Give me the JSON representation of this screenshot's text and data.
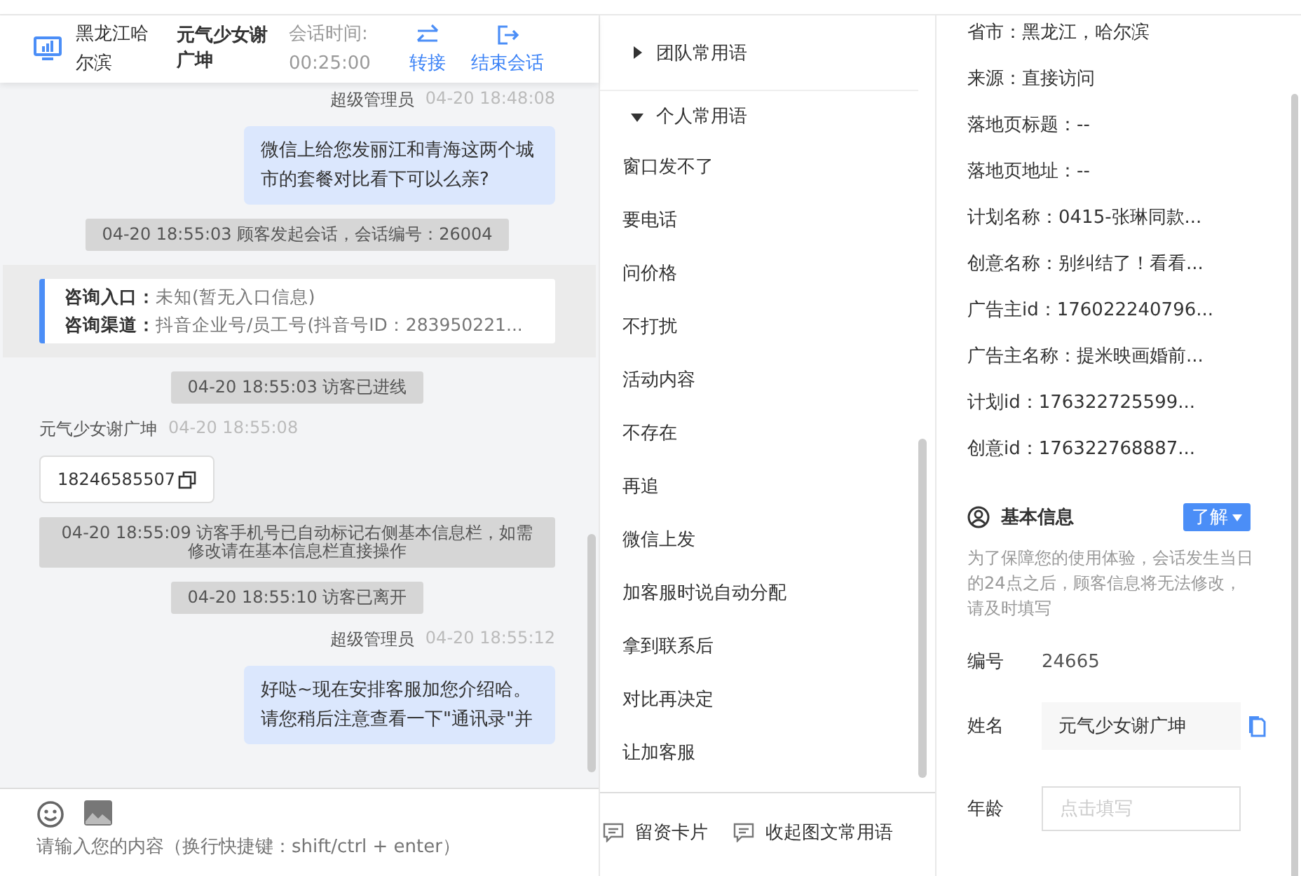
{
  "header": {
    "location": "黑龙江哈尔滨",
    "visitor": "元气少女谢广坤",
    "time_label": "会话时间:",
    "time": "00:25:00",
    "actions": [
      {
        "kind": "transfer",
        "label": "转接"
      },
      {
        "kind": "end",
        "label": "结束会话"
      }
    ]
  },
  "messages": [
    {
      "kind": "agent",
      "name": "超级管理员",
      "time": "04-20 18:48:08",
      "text": "微信上给您发丽江和青海这两个城市的套餐对比看下可以么亲?"
    },
    {
      "kind": "system",
      "text": "04-20 18:55:03 顾客发起会话，会话编号：26004"
    },
    {
      "kind": "entry",
      "rows": [
        {
          "label": "咨询入口：",
          "value": "未知(暂无入口信息)"
        },
        {
          "label": "咨询渠道：",
          "value": "抖音企业号/员工号(抖音号ID：283950221..."
        }
      ]
    },
    {
      "kind": "system",
      "text": "04-20 18:55:03 访客已进线"
    },
    {
      "kind": "visitor",
      "name": "元气少女谢广坤",
      "time": "04-20 18:55:08",
      "text": "18246585507"
    },
    {
      "kind": "system",
      "text": "04-20 18:55:09 访客手机号已自动标记右侧基本信息栏，如需修改请在基本信息栏直接操作"
    },
    {
      "kind": "system",
      "text": "04-20 18:55:10 访客已离开"
    },
    {
      "kind": "agent",
      "name": "超级管理员",
      "time": "04-20 18:55:12",
      "text": "好哒~现在安排客服加您介绍哈。请您稍后注意查看一下\"通讯录\"并"
    }
  ],
  "composer": {
    "placeholder": "请输入您的内容（换行快捷键：shift/ctrl + enter）"
  },
  "phrases": {
    "groups": [
      {
        "title": "团队常用语",
        "expanded": false
      },
      {
        "title": "个人常用语",
        "expanded": true,
        "children": [
          {
            "label": "窗口发不了"
          },
          {
            "label": "要电话"
          },
          {
            "label": "问价格"
          },
          {
            "label": "不打扰"
          },
          {
            "label": "活动内容"
          },
          {
            "label": "不存在"
          },
          {
            "label": "再追"
          },
          {
            "label": "微信上发"
          },
          {
            "label": "加客服时说自动分配"
          },
          {
            "label": "拿到联系后"
          },
          {
            "label": "对比再决定"
          },
          {
            "label": "让加客服"
          }
        ]
      }
    ],
    "actions": [
      {
        "label": "留资卡片"
      },
      {
        "label": "收起图文常用语"
      }
    ]
  },
  "visitor_info": {
    "rows": [
      "省市：黑龙江，哈尔滨",
      "来源：直接访问",
      "落地页标题：--",
      "落地页地址：--",
      "计划名称：0415-张琳同款...",
      "创意名称：别纠结了！看看...",
      "广告主id：176022240796...",
      "广告主名称：提米映画婚前...",
      "计划id：176322725599...",
      "创意id：176322768887..."
    ]
  },
  "basic_info": {
    "title": "基本信息",
    "button": "了解",
    "note": "为了保障您的使用体验，会话发生当日的24点之后，顾客信息将无法修改，请及时填写",
    "fields": [
      {
        "kind": "text",
        "label": "编号",
        "value": "24665"
      },
      {
        "kind": "copy",
        "label": "姓名",
        "value": "元气少女谢广坤"
      },
      {
        "kind": "input",
        "label": "年龄",
        "placeholder": "点击填写"
      }
    ]
  }
}
